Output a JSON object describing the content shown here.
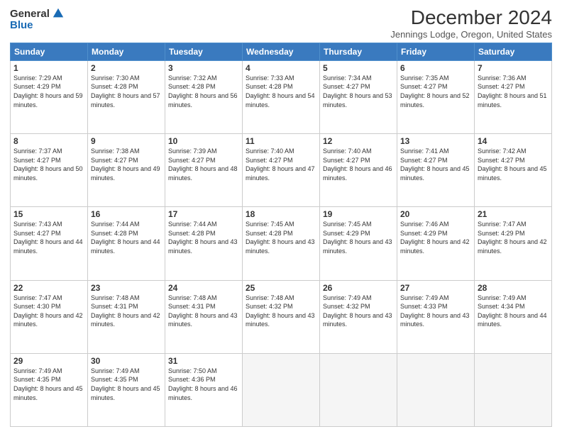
{
  "logo": {
    "general": "General",
    "blue": "Blue"
  },
  "title": "December 2024",
  "subtitle": "Jennings Lodge, Oregon, United States",
  "weekdays": [
    "Sunday",
    "Monday",
    "Tuesday",
    "Wednesday",
    "Thursday",
    "Friday",
    "Saturday"
  ],
  "weeks": [
    [
      {
        "day": 1,
        "sunrise": "7:29 AM",
        "sunset": "4:29 PM",
        "daylight": "8 hours and 59 minutes."
      },
      {
        "day": 2,
        "sunrise": "7:30 AM",
        "sunset": "4:28 PM",
        "daylight": "8 hours and 57 minutes."
      },
      {
        "day": 3,
        "sunrise": "7:32 AM",
        "sunset": "4:28 PM",
        "daylight": "8 hours and 56 minutes."
      },
      {
        "day": 4,
        "sunrise": "7:33 AM",
        "sunset": "4:28 PM",
        "daylight": "8 hours and 54 minutes."
      },
      {
        "day": 5,
        "sunrise": "7:34 AM",
        "sunset": "4:27 PM",
        "daylight": "8 hours and 53 minutes."
      },
      {
        "day": 6,
        "sunrise": "7:35 AM",
        "sunset": "4:27 PM",
        "daylight": "8 hours and 52 minutes."
      },
      {
        "day": 7,
        "sunrise": "7:36 AM",
        "sunset": "4:27 PM",
        "daylight": "8 hours and 51 minutes."
      }
    ],
    [
      {
        "day": 8,
        "sunrise": "7:37 AM",
        "sunset": "4:27 PM",
        "daylight": "8 hours and 50 minutes."
      },
      {
        "day": 9,
        "sunrise": "7:38 AM",
        "sunset": "4:27 PM",
        "daylight": "8 hours and 49 minutes."
      },
      {
        "day": 10,
        "sunrise": "7:39 AM",
        "sunset": "4:27 PM",
        "daylight": "8 hours and 48 minutes."
      },
      {
        "day": 11,
        "sunrise": "7:40 AM",
        "sunset": "4:27 PM",
        "daylight": "8 hours and 47 minutes."
      },
      {
        "day": 12,
        "sunrise": "7:40 AM",
        "sunset": "4:27 PM",
        "daylight": "8 hours and 46 minutes."
      },
      {
        "day": 13,
        "sunrise": "7:41 AM",
        "sunset": "4:27 PM",
        "daylight": "8 hours and 45 minutes."
      },
      {
        "day": 14,
        "sunrise": "7:42 AM",
        "sunset": "4:27 PM",
        "daylight": "8 hours and 45 minutes."
      }
    ],
    [
      {
        "day": 15,
        "sunrise": "7:43 AM",
        "sunset": "4:27 PM",
        "daylight": "8 hours and 44 minutes."
      },
      {
        "day": 16,
        "sunrise": "7:44 AM",
        "sunset": "4:28 PM",
        "daylight": "8 hours and 44 minutes."
      },
      {
        "day": 17,
        "sunrise": "7:44 AM",
        "sunset": "4:28 PM",
        "daylight": "8 hours and 43 minutes."
      },
      {
        "day": 18,
        "sunrise": "7:45 AM",
        "sunset": "4:28 PM",
        "daylight": "8 hours and 43 minutes."
      },
      {
        "day": 19,
        "sunrise": "7:45 AM",
        "sunset": "4:29 PM",
        "daylight": "8 hours and 43 minutes."
      },
      {
        "day": 20,
        "sunrise": "7:46 AM",
        "sunset": "4:29 PM",
        "daylight": "8 hours and 42 minutes."
      },
      {
        "day": 21,
        "sunrise": "7:47 AM",
        "sunset": "4:29 PM",
        "daylight": "8 hours and 42 minutes."
      }
    ],
    [
      {
        "day": 22,
        "sunrise": "7:47 AM",
        "sunset": "4:30 PM",
        "daylight": "8 hours and 42 minutes."
      },
      {
        "day": 23,
        "sunrise": "7:48 AM",
        "sunset": "4:31 PM",
        "daylight": "8 hours and 42 minutes."
      },
      {
        "day": 24,
        "sunrise": "7:48 AM",
        "sunset": "4:31 PM",
        "daylight": "8 hours and 43 minutes."
      },
      {
        "day": 25,
        "sunrise": "7:48 AM",
        "sunset": "4:32 PM",
        "daylight": "8 hours and 43 minutes."
      },
      {
        "day": 26,
        "sunrise": "7:49 AM",
        "sunset": "4:32 PM",
        "daylight": "8 hours and 43 minutes."
      },
      {
        "day": 27,
        "sunrise": "7:49 AM",
        "sunset": "4:33 PM",
        "daylight": "8 hours and 43 minutes."
      },
      {
        "day": 28,
        "sunrise": "7:49 AM",
        "sunset": "4:34 PM",
        "daylight": "8 hours and 44 minutes."
      }
    ],
    [
      {
        "day": 29,
        "sunrise": "7:49 AM",
        "sunset": "4:35 PM",
        "daylight": "8 hours and 45 minutes."
      },
      {
        "day": 30,
        "sunrise": "7:49 AM",
        "sunset": "4:35 PM",
        "daylight": "8 hours and 45 minutes."
      },
      {
        "day": 31,
        "sunrise": "7:50 AM",
        "sunset": "4:36 PM",
        "daylight": "8 hours and 46 minutes."
      },
      null,
      null,
      null,
      null
    ]
  ],
  "labels": {
    "sunrise": "Sunrise:",
    "sunset": "Sunset:",
    "daylight": "Daylight:"
  }
}
